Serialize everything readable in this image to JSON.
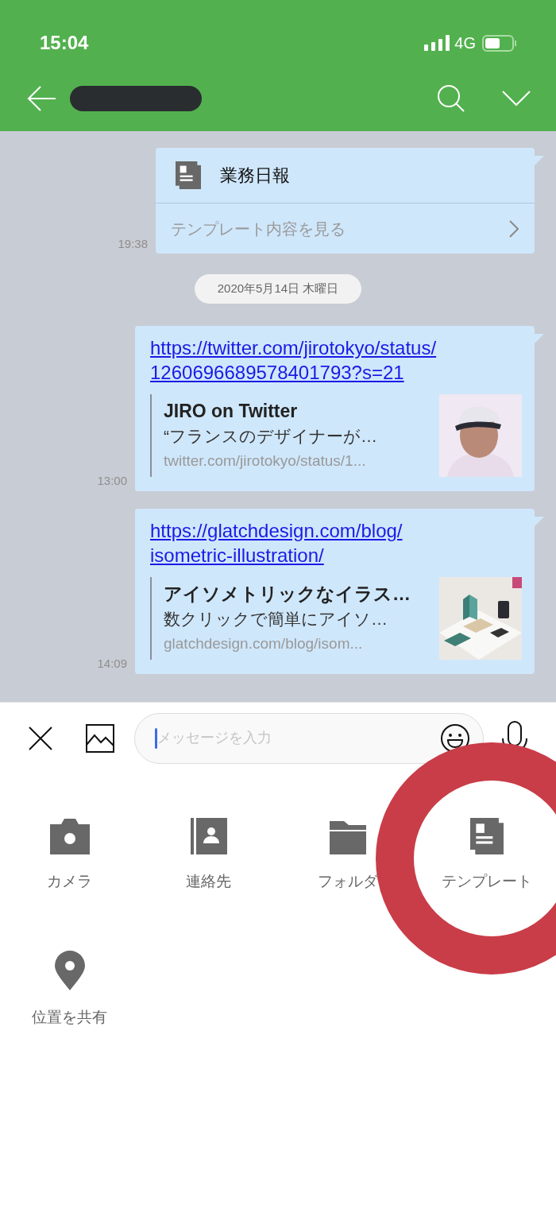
{
  "status_bar": {
    "time": "15:04",
    "network": "4G",
    "battery": {
      "level": 0.55
    }
  },
  "messages": [
    {
      "kind": "template",
      "title": "業務日報",
      "action": "テンプレート内容を見る",
      "time": "19:38"
    },
    {
      "kind": "date",
      "text": "2020年5月14日 木曜日"
    },
    {
      "kind": "link",
      "url_lines": [
        "https://twitter.com/jirotokyo/status/",
        "1260696689578401793?s=21"
      ],
      "preview": {
        "title": "JIRO on Twitter",
        "description": "“フランスのデザイナーが…",
        "domain": "twitter.com/jirotokyo/status/1..."
      },
      "time": "13:00"
    },
    {
      "kind": "link",
      "url_lines": [
        "https://glatchdesign.com/blog/",
        "isometric-illustration/"
      ],
      "preview": {
        "title": "アイソメトリックなイラス…",
        "description": "数クリックで簡単にアイソ…",
        "domain": "glatchdesign.com/blog/isom..."
      },
      "time": "14:09"
    }
  ],
  "composer": {
    "placeholder": "メッセージを入力",
    "focused": true
  },
  "menu": [
    {
      "kind": "camera",
      "label": "カメラ"
    },
    {
      "kind": "contact",
      "label": "連絡先"
    },
    {
      "kind": "folder",
      "label": "フォルダ"
    },
    {
      "kind": "template",
      "label": "テンプレート"
    },
    {
      "kind": "location",
      "label": "位置を共有"
    }
  ]
}
